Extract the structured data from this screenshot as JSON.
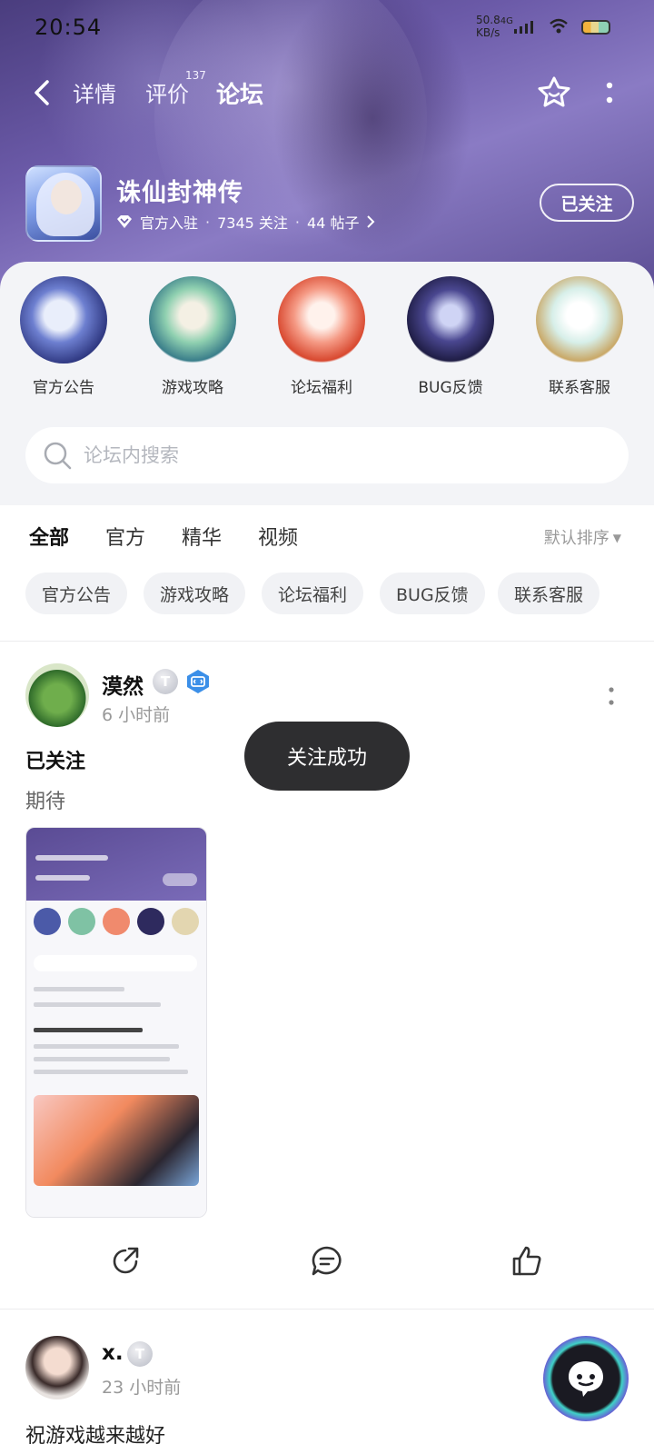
{
  "status_bar": {
    "time": "20:54",
    "speed_value": "50.8",
    "speed_unit": "KB/s",
    "network": "4G",
    "wifi_sub": "6"
  },
  "nav": {
    "details": "详情",
    "reviews": "评价",
    "reviews_count": "137",
    "forum": "论坛"
  },
  "game": {
    "title": "诛仙封神传",
    "official_label": "官方入驻",
    "followers": "7345 关注",
    "posts": "44 帖子",
    "follow_state": "已关注"
  },
  "categories": [
    {
      "label": "官方公告"
    },
    {
      "label": "游戏攻略"
    },
    {
      "label": "论坛福利"
    },
    {
      "label": "BUG反馈"
    },
    {
      "label": "联系客服"
    }
  ],
  "search": {
    "placeholder": "论坛内搜索"
  },
  "filter_tabs": {
    "all": "全部",
    "official": "官方",
    "essence": "精华",
    "video": "视频",
    "sort": "默认排序"
  },
  "chips": [
    "官方公告",
    "游戏攻略",
    "论坛福利",
    "BUG反馈",
    "联系客服"
  ],
  "posts": [
    {
      "username": "漠然",
      "level": "T",
      "time": "6 小时前",
      "title": "已关注",
      "body": "期待"
    },
    {
      "username": "x.",
      "level": "T",
      "time": "23 小时前",
      "body": "祝游戏越来越好"
    }
  ],
  "toast": {
    "text": "关注成功"
  },
  "colors": {
    "accent": "#3fd2c7",
    "banner": "#6b5aa8",
    "toast_bg": "#2e2e30"
  }
}
